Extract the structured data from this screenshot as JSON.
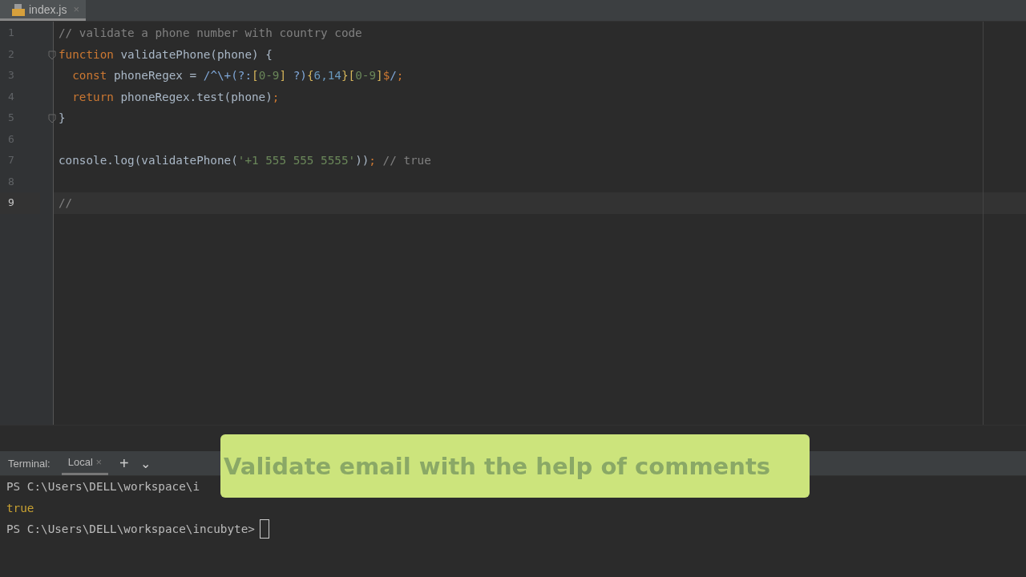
{
  "tabs": [
    {
      "label": "index.js",
      "selected": true,
      "close": "×"
    }
  ],
  "code_lines": [
    {
      "number": "1",
      "current": false,
      "fold": false,
      "tokens": [
        {
          "kind": "comment",
          "text": "// validate a phone number with country code"
        }
      ]
    },
    {
      "number": "2",
      "current": false,
      "fold": true,
      "tokens": [
        {
          "kind": "keyword",
          "text": "function "
        },
        {
          "kind": "plain",
          "text": "validatePhone(phone) {"
        }
      ]
    },
    {
      "number": "3",
      "current": false,
      "fold": false,
      "tokens": [
        {
          "kind": "keyword",
          "text": "  const "
        },
        {
          "kind": "plain",
          "text": "phoneRegex = "
        },
        {
          "kind": "regex",
          "text": "/^\\+(?:"
        },
        {
          "kind": "bracket",
          "text": "["
        },
        {
          "kind": "string",
          "text": "0-9"
        },
        {
          "kind": "bracket",
          "text": "]"
        },
        {
          "kind": "regex",
          "text": " ?)"
        },
        {
          "kind": "bracket",
          "text": "{"
        },
        {
          "kind": "number",
          "text": "6,14"
        },
        {
          "kind": "bracket",
          "text": "}["
        },
        {
          "kind": "string",
          "text": "0-9"
        },
        {
          "kind": "bracket",
          "text": "]"
        },
        {
          "kind": "keyword",
          "text": "$"
        },
        {
          "kind": "regex",
          "text": "/"
        },
        {
          "kind": "keyword",
          "text": ";"
        }
      ]
    },
    {
      "number": "4",
      "current": false,
      "fold": false,
      "tokens": [
        {
          "kind": "keyword",
          "text": "  return "
        },
        {
          "kind": "plain",
          "text": "phoneRegex.test(phone)"
        },
        {
          "kind": "keyword",
          "text": ";"
        }
      ]
    },
    {
      "number": "5",
      "current": false,
      "fold": true,
      "tokens": [
        {
          "kind": "plain",
          "text": "}"
        }
      ]
    },
    {
      "number": "6",
      "current": false,
      "fold": false
    },
    {
      "number": "7",
      "current": false,
      "fold": false,
      "tokens": [
        {
          "kind": "plain",
          "text": "console.log(validatePhone("
        },
        {
          "kind": "string",
          "text": "'+1 555 555 5555'"
        },
        {
          "kind": "plain",
          "text": "))"
        },
        {
          "kind": "keyword",
          "text": ";"
        },
        {
          "kind": "comment",
          "text": " // true"
        }
      ]
    },
    {
      "number": "8",
      "current": false,
      "fold": false
    },
    {
      "number": "9",
      "current": true,
      "fold": false,
      "tokens": [
        {
          "kind": "comment",
          "text": "//"
        }
      ]
    }
  ],
  "terminal": {
    "title": "Terminal:",
    "tabs": [
      {
        "label": "Local",
        "selected": true,
        "close": "×"
      }
    ],
    "add": "+",
    "menu": "⌄",
    "lines": [
      {
        "kind": "prompt",
        "text": "PS C:\\Users\\DELL\\workspace\\i"
      },
      {
        "kind": "output",
        "text": "true"
      },
      {
        "kind": "prompt",
        "text": "PS C:\\Users\\DELL\\workspace\\incubyte>",
        "cursor": true
      }
    ]
  },
  "caption": "Validate email with the help of comments"
}
